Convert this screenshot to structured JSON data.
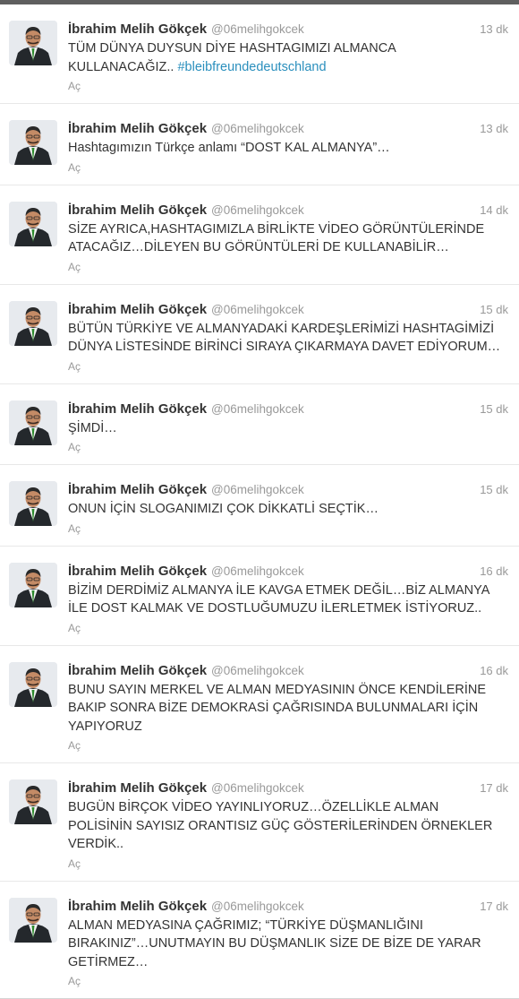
{
  "user": {
    "fullname": "İbrahim Melih Gökçek",
    "username": "@06melihgokcek",
    "expand_label": "Aç"
  },
  "colors": {
    "hashtag": "#2a8fbd",
    "meta": "#999999",
    "text": "#333333"
  },
  "tweets": [
    {
      "time": "13 dk",
      "text": "TÜM DÜNYA DUYSUN DİYE HASHTAGIMIZI ALMANCA KULLANACAĞIZ.. ",
      "hashtag": "#bleibfreundedeutschland"
    },
    {
      "time": "13 dk",
      "text": "Hashtagımızın Türkçe anlamı “DOST KAL ALMANYA”…",
      "hashtag": ""
    },
    {
      "time": "14 dk",
      "text": "SİZE AYRICA,HASHTAGIMIZLA BİRLİKTE VİDEO GÖRÜNTÜLERİNDE ATACAĞIZ…DİLEYEN BU GÖRÜNTÜLERİ DE KULLANABİLİR…",
      "hashtag": ""
    },
    {
      "time": "15 dk",
      "text": "BÜTÜN TÜRKİYE VE ALMANYADAKİ KARDEŞLERİMİZİ HASHTAGİMİZİ DÜNYA LİSTESİNDE BİRİNCİ SIRAYA ÇIKARMAYA DAVET EDİYORUM…",
      "hashtag": ""
    },
    {
      "time": "15 dk",
      "text": "ŞİMDİ…",
      "hashtag": ""
    },
    {
      "time": "15 dk",
      "text": "ONUN İÇİN SLOGANIMIZI ÇOK DİKKATLİ SEÇTİK…",
      "hashtag": ""
    },
    {
      "time": "16 dk",
      "text": "BİZİM DERDİMİZ ALMANYA İLE KAVGA ETMEK DEĞİL…BİZ ALMANYA İLE DOST KALMAK VE DOSTLUĞUMUZU İLERLETMEK İSTİYORUZ..",
      "hashtag": ""
    },
    {
      "time": "16 dk",
      "text": "BUNU SAYIN MERKEL VE ALMAN MEDYASININ ÖNCE KENDİLERİNE BAKIP SONRA BİZE DEMOKRASİ ÇAĞRISINDA BULUNMALARI İÇİN YAPIYORUZ",
      "hashtag": ""
    },
    {
      "time": "17 dk",
      "text": "BUGÜN BİRÇOK VİDEO YAYINLIYORUZ…ÖZELLİKLE ALMAN POLİSİNİN SAYISIZ ORANTISIZ GÜÇ GÖSTERİLERİNDEN ÖRNEKLER VERDİK..",
      "hashtag": ""
    },
    {
      "time": "17 dk",
      "text": "ALMAN MEDYASINA ÇAĞRIMIZ; “TÜRKİYE DÜŞMANLIĞINI BIRAKINIZ”…UNUTMAYIN BU DÜŞMANLIK SİZE DE BİZE DE YARAR GETİRMEZ…",
      "hashtag": ""
    }
  ]
}
